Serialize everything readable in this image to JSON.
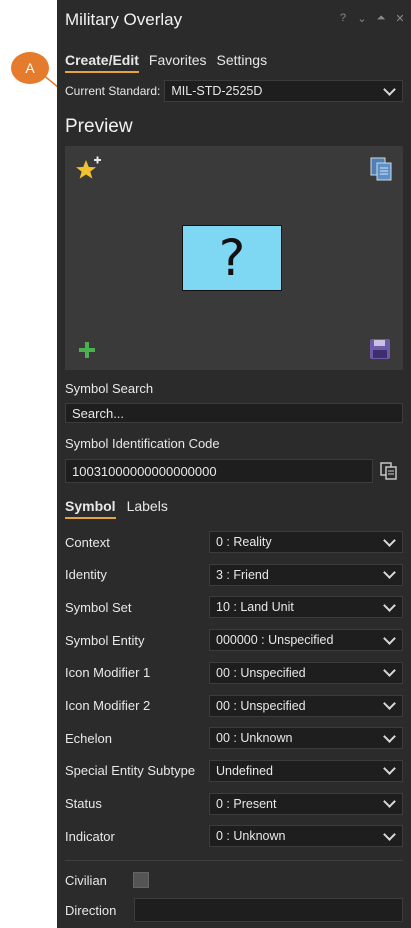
{
  "callout": {
    "letter": "A"
  },
  "window": {
    "title": "Military Overlay"
  },
  "tabs": [
    {
      "label": "Create/Edit"
    },
    {
      "label": "Favorites"
    },
    {
      "label": "Settings"
    }
  ],
  "standard": {
    "label": "Current Standard:",
    "value": "MIL-STD-2525D"
  },
  "preview": {
    "heading": "Preview",
    "symbol_glyph": "?"
  },
  "search": {
    "label": "Symbol Search",
    "placeholder": "Search..."
  },
  "sidc": {
    "label": "Symbol Identification Code",
    "value": "10031000000000000000"
  },
  "subtabs": [
    {
      "label": "Symbol"
    },
    {
      "label": "Labels"
    }
  ],
  "properties": [
    {
      "label": "Context",
      "value": "0 : Reality"
    },
    {
      "label": "Identity",
      "value": "3 : Friend"
    },
    {
      "label": "Symbol Set",
      "value": "10 : Land Unit"
    },
    {
      "label": "Symbol Entity",
      "value": "000000 : Unspecified"
    },
    {
      "label": "Icon Modifier 1",
      "value": "00 : Unspecified"
    },
    {
      "label": "Icon Modifier 2",
      "value": "00 : Unspecified"
    },
    {
      "label": "Echelon",
      "value": "00 : Unknown"
    },
    {
      "label": "Special Entity Subtype",
      "value": "Undefined"
    },
    {
      "label": "Status",
      "value": "0 : Present"
    },
    {
      "label": "Indicator",
      "value": "0 : Unknown"
    }
  ],
  "civilian": {
    "label": "Civilian",
    "checked": false
  },
  "direction": {
    "label": "Direction",
    "value": ""
  },
  "colors": {
    "accent": "#e8a33c",
    "callout": "#e57b2c",
    "preview_symbol": "#7ed8f3"
  }
}
